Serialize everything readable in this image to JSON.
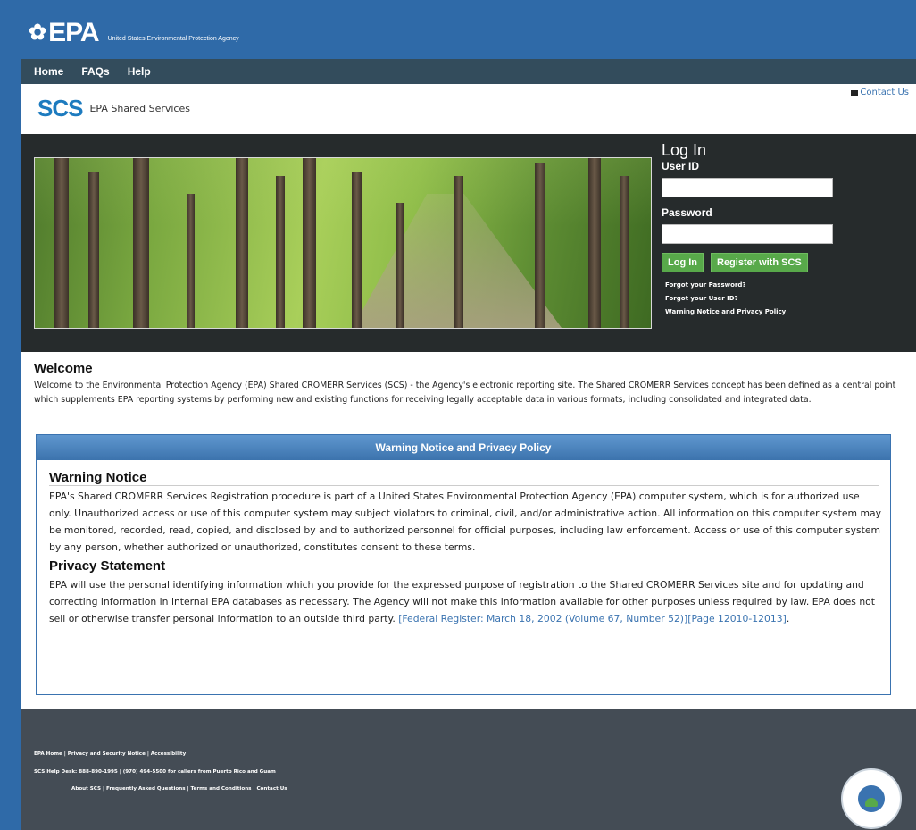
{
  "epa": {
    "logo_mark": "EPA",
    "agency": "United States Environmental Protection Agency"
  },
  "nav": {
    "items": [
      "Home",
      "FAQs",
      "Help"
    ]
  },
  "scs": {
    "logo": "SCS",
    "name": "EPA Shared Services",
    "contact": "Contact Us"
  },
  "login": {
    "title": "Log In",
    "user_label": "User ID",
    "password_label": "Password",
    "login_button": "Log In",
    "register_button": "Register with SCS",
    "forgot_password": "Forgot your Password?",
    "forgot_user": "Forgot your User ID?",
    "warning_link": "Warning Notice and Privacy Policy"
  },
  "welcome": {
    "title": "Welcome",
    "text": "Welcome to the Environmental Protection Agency (EPA) Shared CROMERR Services (SCS) - the Agency's electronic reporting site. The Shared CROMERR Services concept has been defined as a central point which supplements EPA reporting systems by performing new and existing functions for receiving legally acceptable data in various formats, including consolidated and integrated data."
  },
  "policy": {
    "header": "Warning Notice and Privacy Policy",
    "warning_title": "Warning Notice",
    "warning_text": "EPA's Shared CROMERR Services Registration procedure is part of a United States Environmental Protection Agency (EPA) computer system, which is for authorized use only. Unauthorized access or use of this computer system may subject violators to criminal, civil, and/or administrative action. All information on this computer system may be monitored, recorded, read, copied, and disclosed by and to authorized personnel for official purposes, including law enforcement. Access or use of this computer system by any person, whether authorized or unauthorized, constitutes consent to these terms.",
    "privacy_title": "Privacy Statement",
    "privacy_text": "EPA will use the personal identifying information which you provide for the expressed purpose of registration to the Shared CROMERR Services site and for updating and correcting information in internal EPA databases as necessary. The Agency will not make this information available for other purposes unless required by law. EPA does not sell or otherwise transfer personal information to an outside third party.",
    "privacy_link": "[Federal Register: March 18, 2002 (Volume 67, Number 52)][Page 12010-12013]",
    "privacy_end": "."
  },
  "footer": {
    "line1": "EPA Home | Privacy and Security Notice | Accessibility",
    "line2": "SCS Help Desk: 888-890-1995 | (970) 494-5500 for callers from Puerto Rico and Guam",
    "line3": "About SCS | Frequently Asked Questions | Terms and Conditions | Contact Us"
  },
  "colors": {
    "banner": "#2f6aa8",
    "nav": "#334c5c",
    "hero": "#262b2c",
    "accent_green": "#58a94a",
    "link_blue": "#3a73b0",
    "footer": "#444c55"
  }
}
